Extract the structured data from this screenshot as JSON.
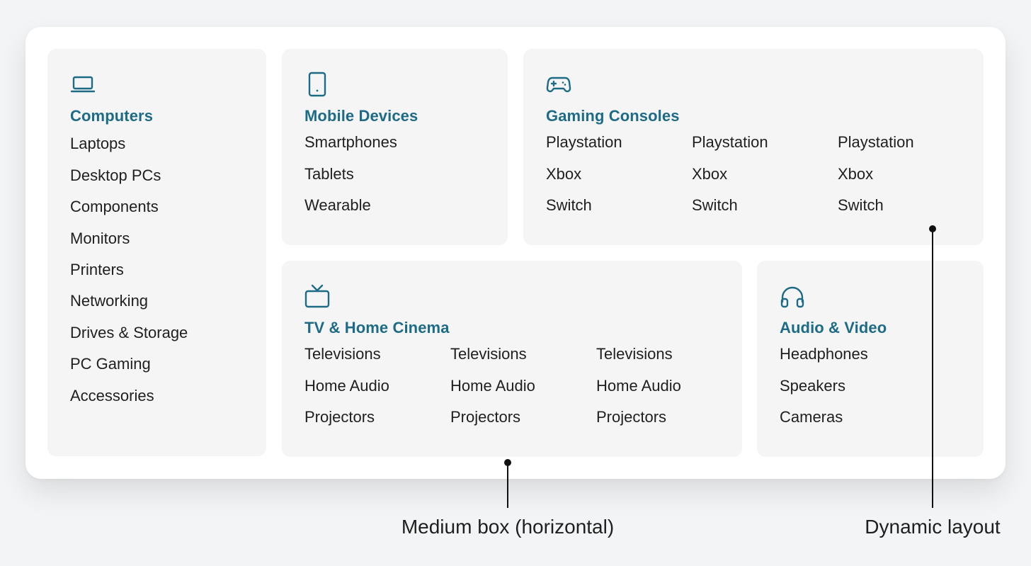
{
  "categories": {
    "computers": {
      "icon": "laptop-icon",
      "title": "Computers",
      "items": [
        "Laptops",
        "Desktop PCs",
        "Components",
        "Monitors",
        "Printers",
        "Networking",
        "Drives & Storage",
        "PC Gaming",
        "Accessories"
      ]
    },
    "mobile": {
      "icon": "tablet-icon",
      "title": "Mobile Devices",
      "items": [
        "Smartphones",
        "Tablets",
        "Wearable"
      ]
    },
    "gaming": {
      "icon": "gamepad-icon",
      "title": "Gaming Consoles",
      "columns": [
        [
          "Playstation",
          "Xbox",
          "Switch"
        ],
        [
          "Playstation",
          "Xbox",
          "Switch"
        ],
        [
          "Playstation",
          "Xbox",
          "Switch"
        ]
      ]
    },
    "tv": {
      "icon": "tv-icon",
      "title": "TV & Home Cinema",
      "columns": [
        [
          "Televisions",
          "Home Audio",
          "Projectors"
        ],
        [
          "Televisions",
          "Home Audio",
          "Projectors"
        ],
        [
          "Televisions",
          "Home Audio",
          "Projectors"
        ]
      ]
    },
    "audio": {
      "icon": "headphones-icon",
      "title": "Audio & Video",
      "items": [
        "Headphones",
        "Speakers",
        "Cameras"
      ]
    }
  },
  "annotations": {
    "medium_box": "Medium box (horizontal)",
    "dynamic_layout": "Dynamic layout"
  },
  "colors": {
    "accent": "#1e6b86",
    "card_bg": "#f5f5f5",
    "page_bg": "#f3f4f6"
  }
}
